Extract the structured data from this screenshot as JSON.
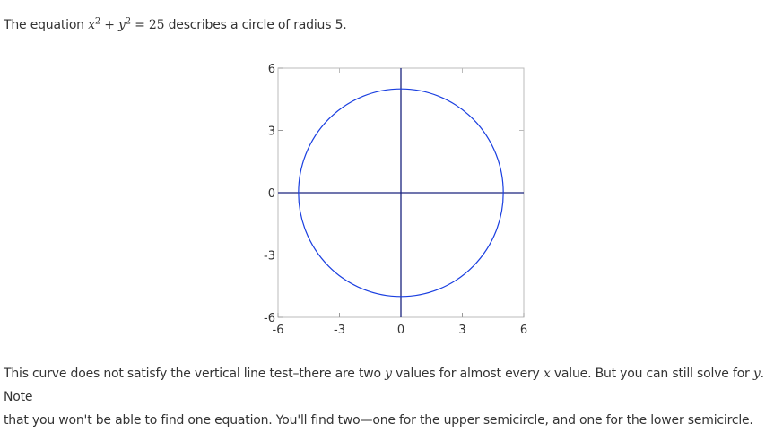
{
  "intro": {
    "text_before": "The equation ",
    "x_var": "x",
    "x_exp": "2",
    "plus": " + ",
    "y_var": "y",
    "y_exp": "2",
    "equals": " = 25",
    "text_after": " describes a circle of radius 5."
  },
  "chart_data": {
    "type": "line",
    "curve": "circle",
    "center": [
      0,
      0
    ],
    "radius": 5,
    "xlim": [
      -6,
      6
    ],
    "ylim": [
      -6,
      6
    ],
    "x_ticks": [
      "-6",
      "-3",
      "0",
      "3",
      "6"
    ],
    "y_ticks": [
      "6",
      "3",
      "0",
      "-3",
      "-6"
    ],
    "x_tick_values": [
      -6,
      -3,
      0,
      3,
      6
    ],
    "y_tick_values": [
      6,
      3,
      0,
      -3,
      -6
    ],
    "curve_color": "#1a3fe0",
    "axis_color": "#1a237e",
    "frame_color": "#bbbbbb"
  },
  "outro": {
    "line1_a": "This curve does not satisfy the vertical line test–there are two ",
    "line1_y": "y",
    "line1_b": " values for almost every ",
    "line1_x": "x",
    "line1_c": " value. But you can still solve for ",
    "line1_y2": "y",
    "line1_d": ". Note",
    "line2": "that you won't be able to find one equation. You'll find two—one for the upper semicircle, and one for the lower semicircle."
  }
}
